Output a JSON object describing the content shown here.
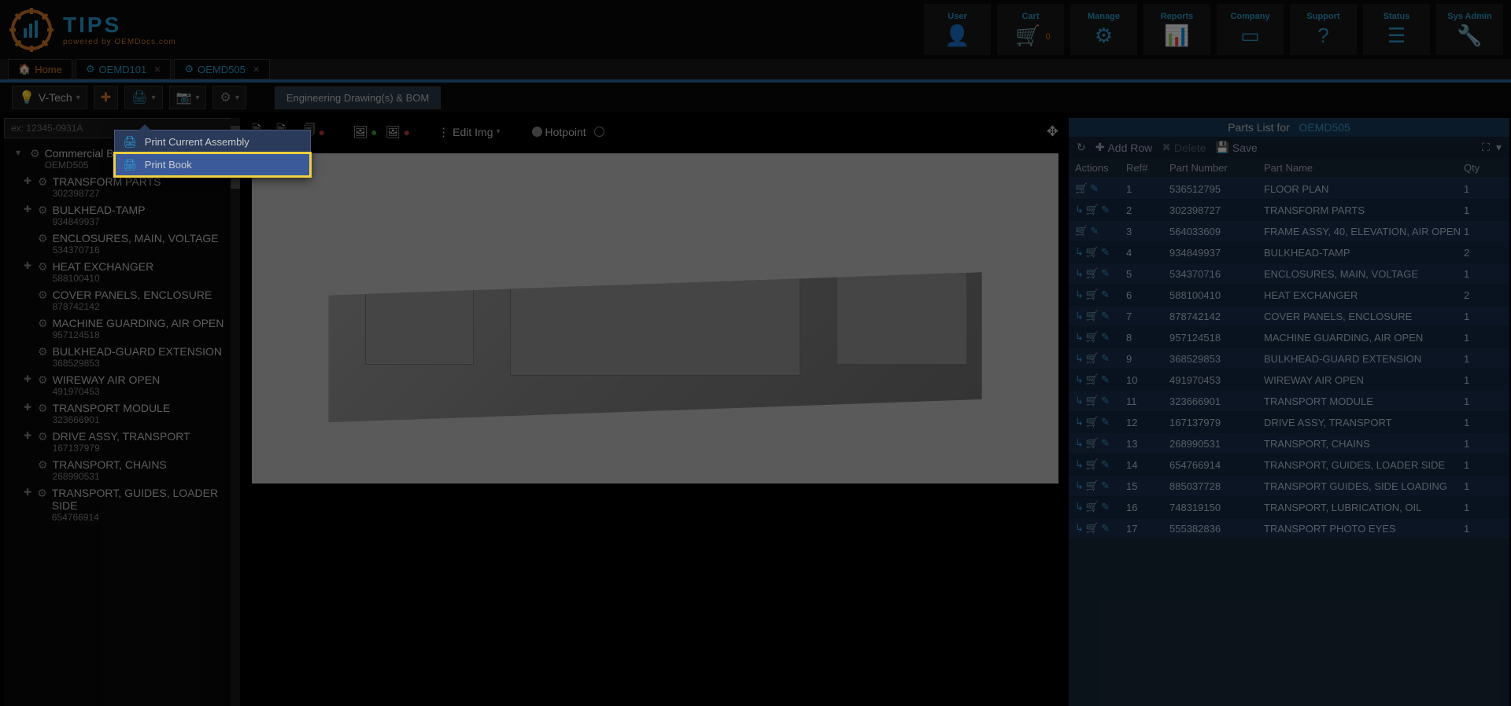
{
  "logo": {
    "title": "TIPS",
    "subtitle": "powered by OEMDocs.com"
  },
  "nav_tiles": [
    {
      "label": "User",
      "icon": "👤"
    },
    {
      "label": "Cart",
      "icon": "🛒",
      "badge": "0"
    },
    {
      "label": "Manage",
      "icon": "⚙"
    },
    {
      "label": "Reports",
      "icon": "📊"
    },
    {
      "label": "Company",
      "icon": "▭"
    },
    {
      "label": "Support",
      "icon": "?"
    },
    {
      "label": "Status",
      "icon": "☰"
    },
    {
      "label": "Sys Admin",
      "icon": "🔧"
    }
  ],
  "tabs": {
    "home": "Home",
    "doc1": "OEMD101",
    "doc2": "OEMD505"
  },
  "toolbar": {
    "vtech": "V-Tech",
    "subtab": "Engineering Drawing(s) & BOM"
  },
  "search": {
    "placeholder": "ex: 12345-0931A"
  },
  "tree": {
    "root": {
      "name": "Commercial Brin...",
      "num": "OEMD505"
    },
    "children": [
      {
        "name": "TRANSFORM PARTS",
        "num": "302398727",
        "expand": true
      },
      {
        "name": "BULKHEAD-TAMP",
        "num": "934849937",
        "expand": true
      },
      {
        "name": "ENCLOSURES, MAIN, VOLTAGE",
        "num": "534370716",
        "expand": false
      },
      {
        "name": "HEAT EXCHANGER",
        "num": "588100410",
        "expand": true
      },
      {
        "name": "COVER PANELS, ENCLOSURE",
        "num": "878742142",
        "expand": false
      },
      {
        "name": "MACHINE GUARDING, AIR OPEN",
        "num": "957124518",
        "expand": false
      },
      {
        "name": "BULKHEAD-GUARD EXTENSION",
        "num": "368529853",
        "expand": false
      },
      {
        "name": "WIREWAY AIR OPEN",
        "num": "491970453",
        "expand": true
      },
      {
        "name": "TRANSPORT MODULE",
        "num": "323666901",
        "expand": true
      },
      {
        "name": "DRIVE ASSY, TRANSPORT",
        "num": "167137979",
        "expand": true
      },
      {
        "name": "TRANSPORT, CHAINS",
        "num": "268990531",
        "expand": false
      },
      {
        "name": "TRANSPORT, GUIDES, LOADER SIDE",
        "num": "654766914",
        "expand": true
      }
    ]
  },
  "canvas_toolbar": {
    "edit_img": "Edit Img",
    "hotpoint": "Hotpoint"
  },
  "print_menu": {
    "item1": "Print Current Assembly",
    "item2": "Print Book"
  },
  "parts": {
    "title_prefix": "Parts List for",
    "doc": "OEMD505",
    "add_row": "Add Row",
    "delete": "Delete",
    "save": "Save",
    "headers": {
      "actions": "Actions",
      "ref": "Ref#",
      "pn": "Part Number",
      "name": "Part Name",
      "qty": "Qty"
    },
    "rows": [
      {
        "ref": "1",
        "pn": "536512795",
        "name": "FLOOR PLAN",
        "qty": "1",
        "drill": false
      },
      {
        "ref": "2",
        "pn": "302398727",
        "name": "TRANSFORM PARTS",
        "qty": "1",
        "drill": true
      },
      {
        "ref": "3",
        "pn": "564033609",
        "name": "FRAME ASSY, 40, ELEVATION, AIR OPEN",
        "qty": "1",
        "drill": false
      },
      {
        "ref": "4",
        "pn": "934849937",
        "name": "BULKHEAD-TAMP",
        "qty": "2",
        "drill": true
      },
      {
        "ref": "5",
        "pn": "534370716",
        "name": "ENCLOSURES, MAIN, VOLTAGE",
        "qty": "1",
        "drill": true
      },
      {
        "ref": "6",
        "pn": "588100410",
        "name": "HEAT EXCHANGER",
        "qty": "2",
        "drill": true
      },
      {
        "ref": "7",
        "pn": "878742142",
        "name": "COVER PANELS, ENCLOSURE",
        "qty": "1",
        "drill": true
      },
      {
        "ref": "8",
        "pn": "957124518",
        "name": "MACHINE GUARDING, AIR OPEN",
        "qty": "1",
        "drill": true
      },
      {
        "ref": "9",
        "pn": "368529853",
        "name": "BULKHEAD-GUARD EXTENSION",
        "qty": "1",
        "drill": true
      },
      {
        "ref": "10",
        "pn": "491970453",
        "name": "WIREWAY AIR OPEN",
        "qty": "1",
        "drill": true
      },
      {
        "ref": "11",
        "pn": "323666901",
        "name": "TRANSPORT MODULE",
        "qty": "1",
        "drill": true
      },
      {
        "ref": "12",
        "pn": "167137979",
        "name": "DRIVE ASSY, TRANSPORT",
        "qty": "1",
        "drill": true
      },
      {
        "ref": "13",
        "pn": "268990531",
        "name": "TRANSPORT, CHAINS",
        "qty": "1",
        "drill": true
      },
      {
        "ref": "14",
        "pn": "654766914",
        "name": "TRANSPORT, GUIDES, LOADER SIDE",
        "qty": "1",
        "drill": true
      },
      {
        "ref": "15",
        "pn": "885037728",
        "name": "TRANSPORT GUIDES, SIDE LOADING",
        "qty": "1",
        "drill": true
      },
      {
        "ref": "16",
        "pn": "748319150",
        "name": "TRANSPORT, LUBRICATION, OIL",
        "qty": "1",
        "drill": true
      },
      {
        "ref": "17",
        "pn": "555382836",
        "name": "TRANSPORT PHOTO EYES",
        "qty": "1",
        "drill": true
      }
    ]
  }
}
